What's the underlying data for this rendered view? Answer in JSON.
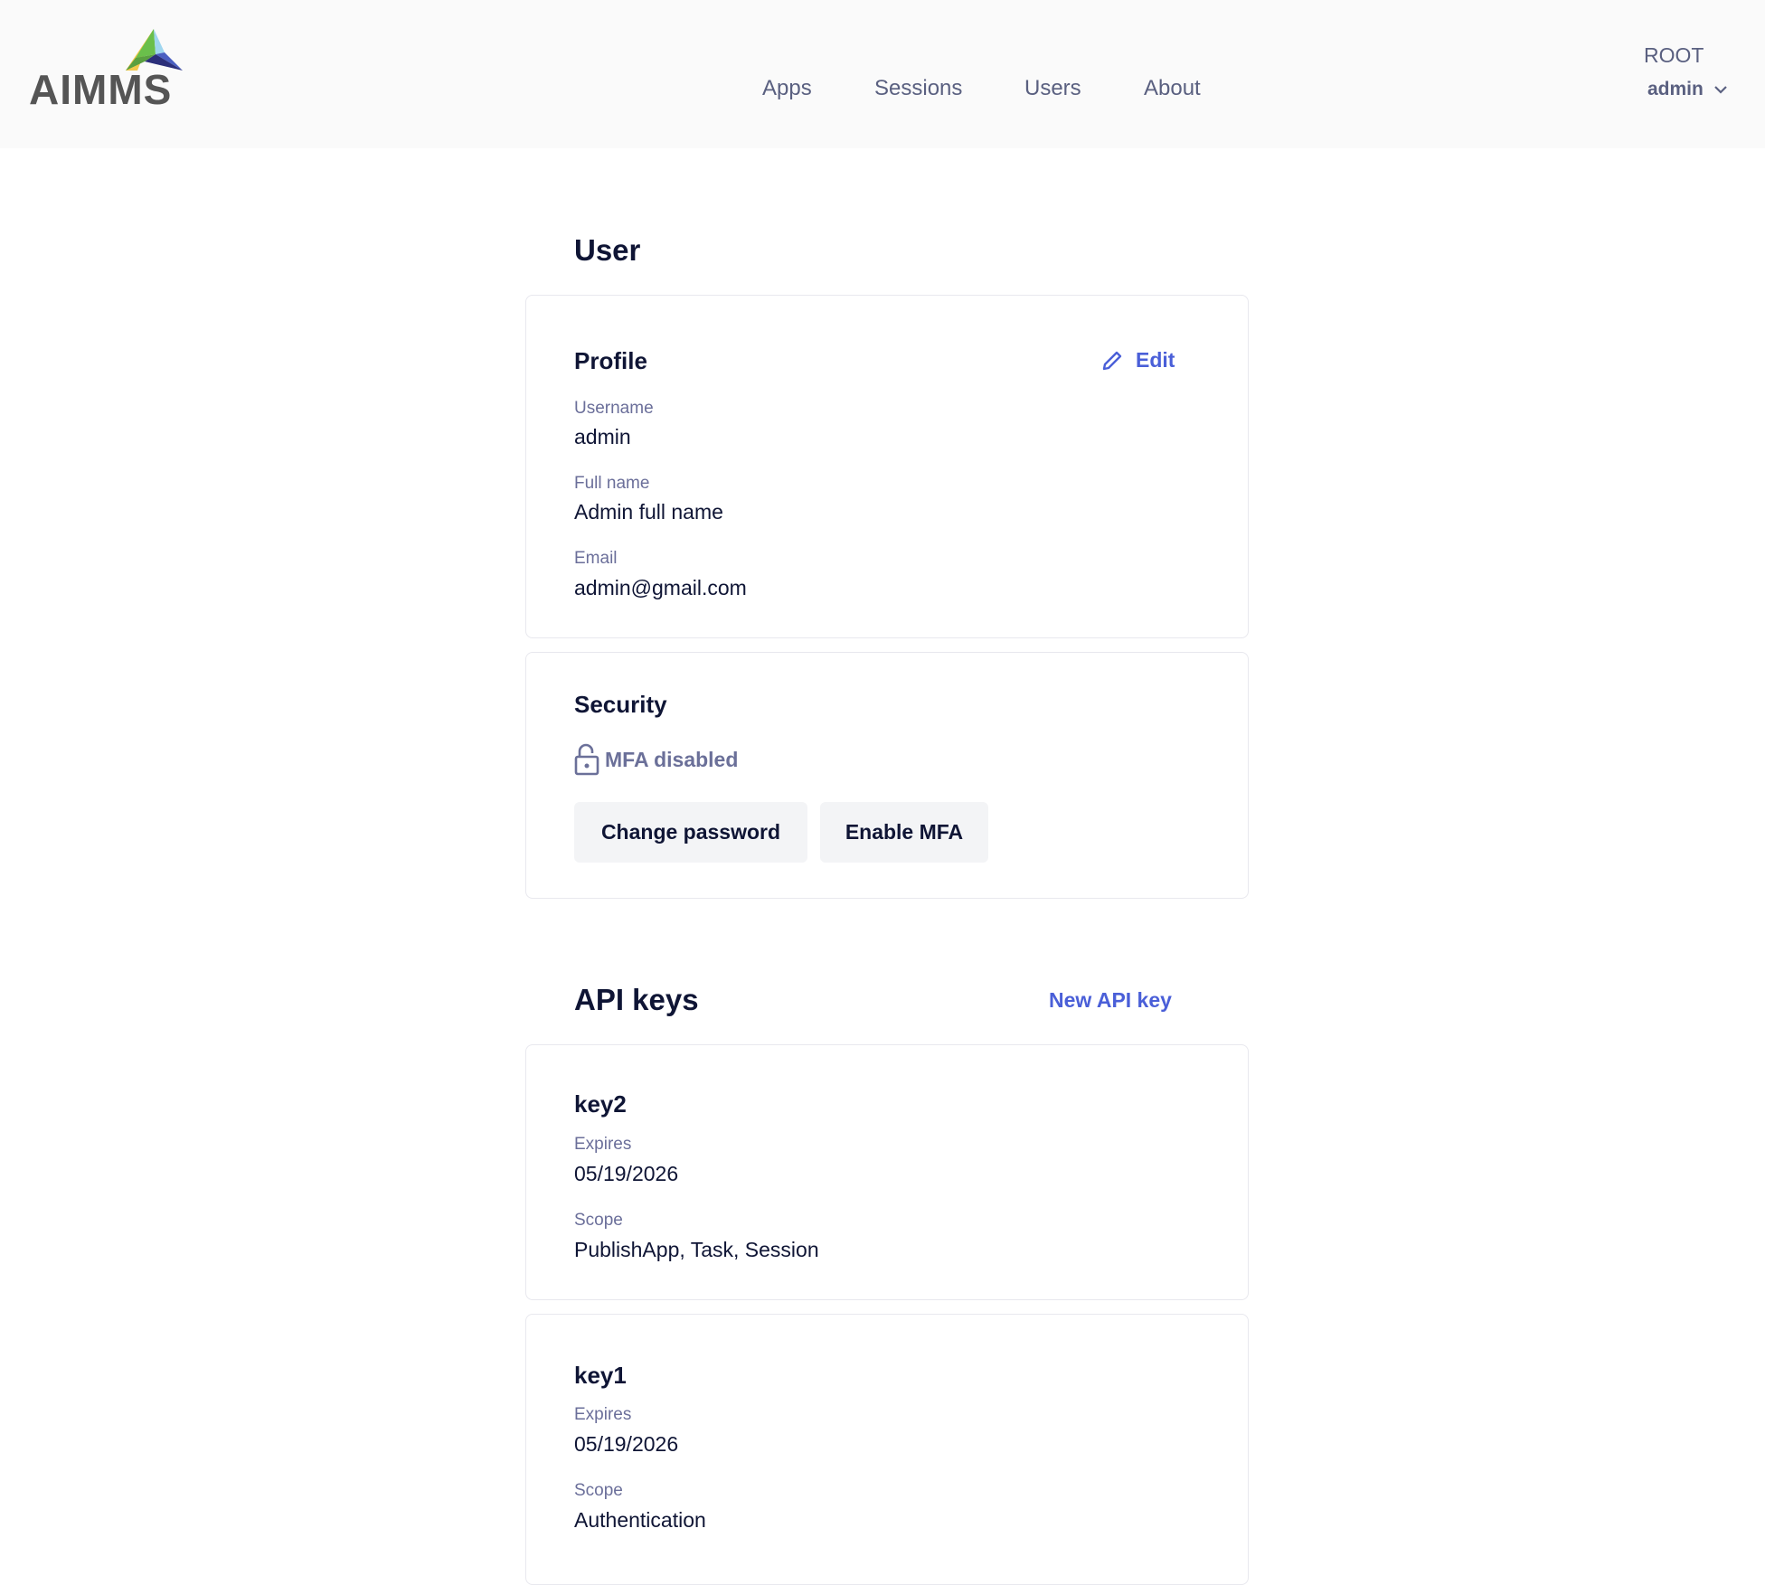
{
  "header": {
    "logo_text": "AIMMS",
    "nav": [
      "Apps",
      "Sessions",
      "Users",
      "About"
    ],
    "tenant": "ROOT",
    "user": "admin"
  },
  "page_title": "User",
  "profile": {
    "heading": "Profile",
    "edit_label": "Edit",
    "fields": [
      {
        "label": "Username",
        "value": "admin"
      },
      {
        "label": "Full name",
        "value": "Admin full name"
      },
      {
        "label": "Email",
        "value": "admin@gmail.com"
      }
    ]
  },
  "security": {
    "heading": "Security",
    "mfa_status": "MFA disabled",
    "change_password": "Change password",
    "enable_mfa": "Enable MFA"
  },
  "api_keys": {
    "heading": "API keys",
    "new_label": "New API key",
    "keys": [
      {
        "name": "key2",
        "expires_label": "Expires",
        "expires": "05/19/2026",
        "scope_label": "Scope",
        "scope": "PublishApp, Task, Session"
      },
      {
        "name": "key1",
        "expires_label": "Expires",
        "expires": "05/19/2026",
        "scope_label": "Scope",
        "scope": "Authentication"
      }
    ]
  },
  "colors": {
    "link": "#4a5fd8",
    "label": "#6b6f9a",
    "text": "#0f1535"
  }
}
